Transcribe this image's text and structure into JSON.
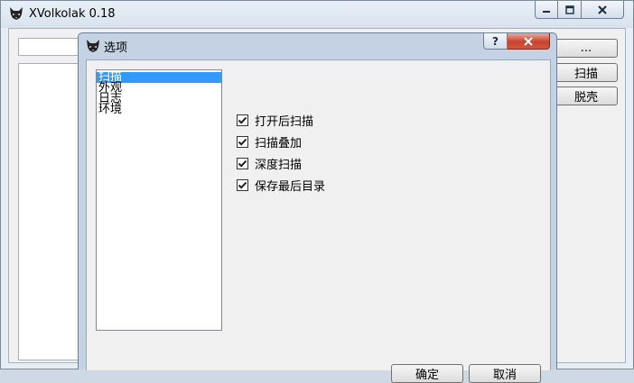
{
  "main_window": {
    "title": "XVolkolak 0.18",
    "path_value": "",
    "browse_label": "...",
    "scan_label": "扫描",
    "unpack_label": "脱壳",
    "icons": [
      "wolf-app-icon",
      "minimize-icon",
      "maximize-icon",
      "close-icon"
    ]
  },
  "options_dialog": {
    "title": "选项",
    "help_label": "?",
    "categories": [
      {
        "label": "扫描",
        "selected": true
      },
      {
        "label": "外观",
        "selected": false
      },
      {
        "label": "日志",
        "selected": false
      },
      {
        "label": "环境",
        "selected": false
      }
    ],
    "options": [
      {
        "label": "打开后扫描",
        "checked": true
      },
      {
        "label": "扫描叠加",
        "checked": true
      },
      {
        "label": "深度扫描",
        "checked": true
      },
      {
        "label": "保存最后目录",
        "checked": true
      }
    ],
    "ok_label": "确定",
    "cancel_label": "取消"
  },
  "colors": {
    "selection": "#3399ff",
    "close_button": "#c7432c",
    "dialog_frame": "#c4d2e3"
  }
}
